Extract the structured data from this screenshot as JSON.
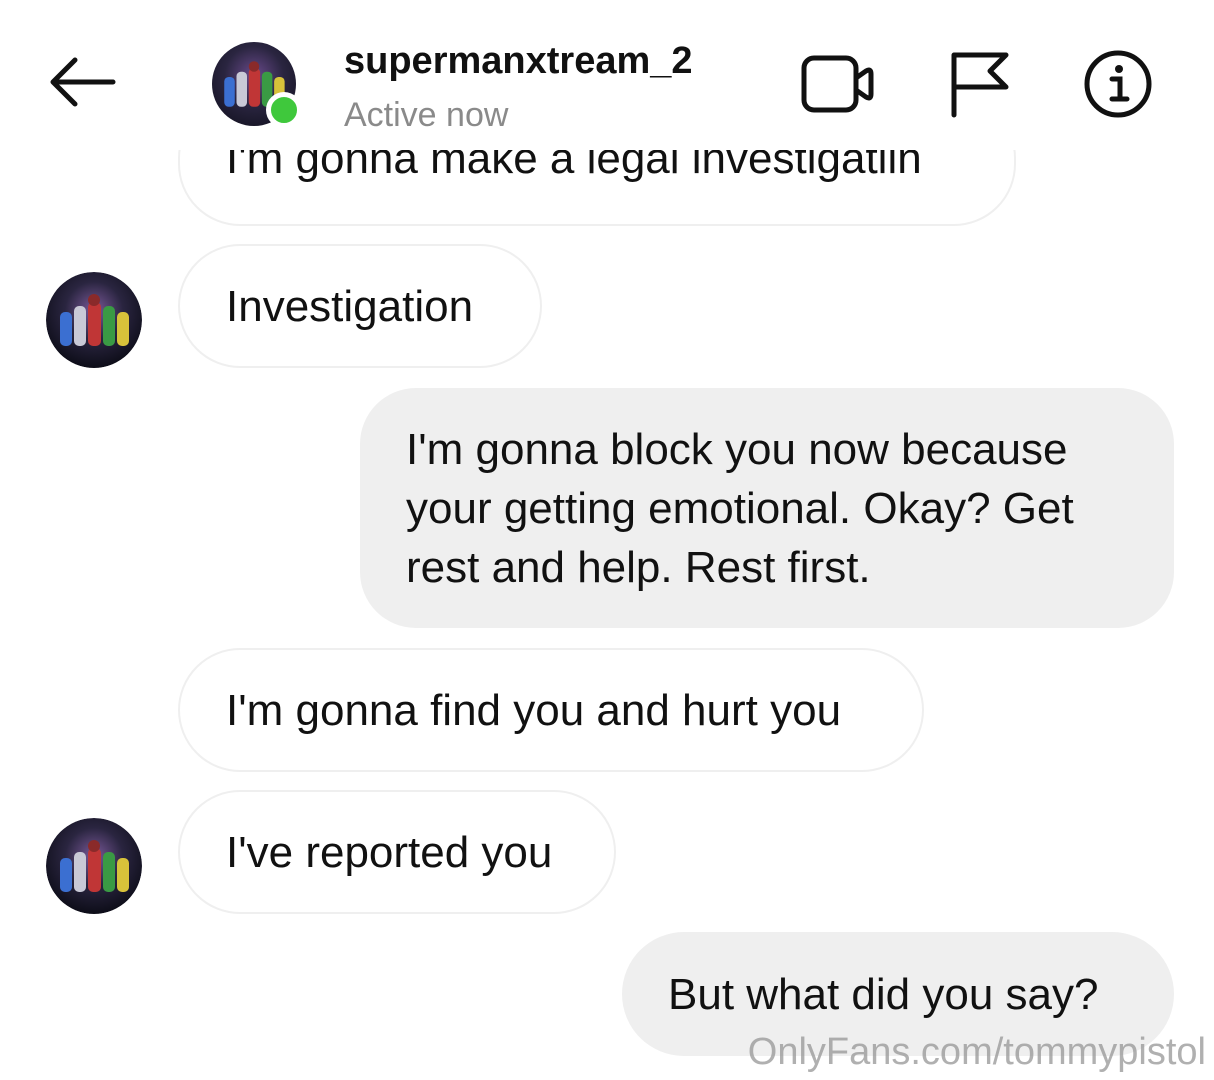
{
  "header": {
    "username": "supermanxtream_2",
    "status": "Active now",
    "back_icon": "arrow-left-icon",
    "video_icon": "video-camera-icon",
    "flag_icon": "flag-icon",
    "info_icon": "info-icon",
    "online_color": "#3fc83c"
  },
  "messages": [
    {
      "sender": "them",
      "text": "I'm gonna make a legal investigatiin"
    },
    {
      "sender": "them",
      "text": "Investigation"
    },
    {
      "sender": "me",
      "text": "I'm gonna block you now because your getting emotional. Okay? Get rest and help. Rest first."
    },
    {
      "sender": "them",
      "text": "I'm gonna find you and hurt you"
    },
    {
      "sender": "them",
      "text": "I've reported you"
    },
    {
      "sender": "me",
      "text": "But what did you say?"
    }
  ],
  "watermark": "OnlyFans.com/tommypistol",
  "colors": {
    "outgoing_bubble": "#efefef",
    "incoming_border": "#efefef",
    "muted_text": "#8a8a8a"
  }
}
